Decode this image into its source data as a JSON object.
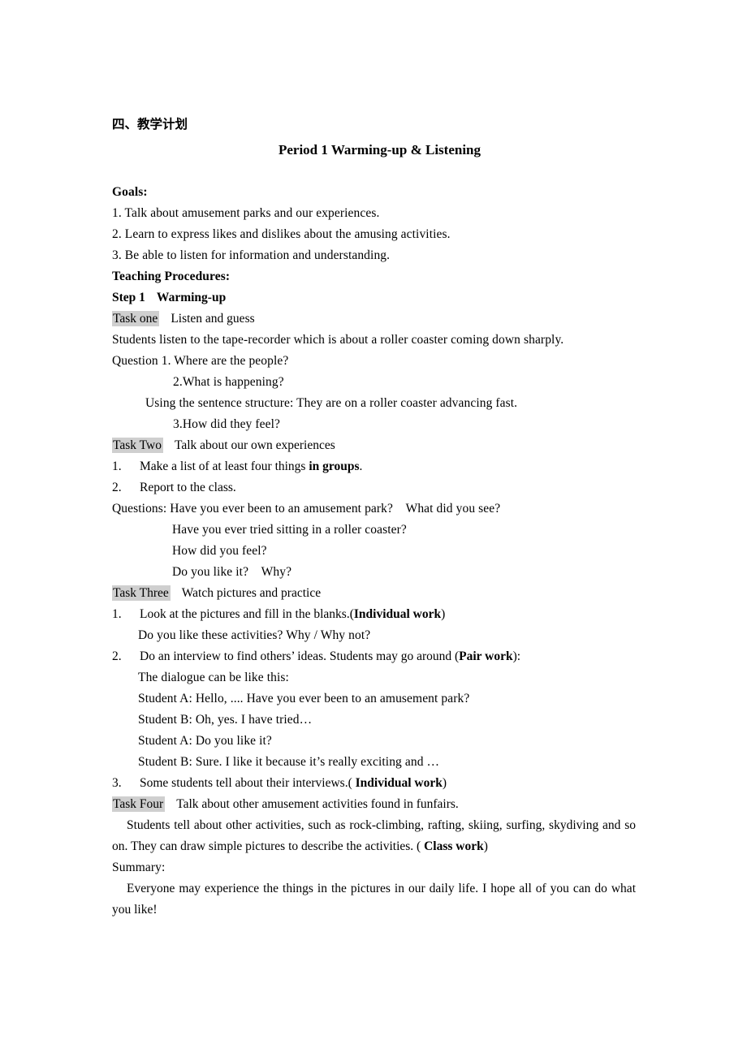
{
  "document": {
    "section_heading": "四、教学计划",
    "title": "Period 1 Warming-up & Listening",
    "goals_heading": "Goals:",
    "goals": [
      "1. Talk about amusement parks and our experiences.",
      "2. Learn to express likes and dislikes about the amusing activities.",
      "3. Be able to listen for information and understanding."
    ],
    "teaching_procedures_heading": "Teaching Procedures:",
    "step1": {
      "label": "Step 1",
      "title": "Warming-up"
    },
    "task_one": {
      "chip": "Task one",
      "heading": "Listen and guess",
      "intro": "Students listen to the tape-recorder which is about a roller coaster coming down sharply.",
      "question_1": "Question 1. Where are the people?",
      "question_2": "2.What is happening?",
      "structure": "Using the sentence structure: They are on a roller coaster advancing fast.",
      "question_3": "3.How did they feel?"
    },
    "task_two": {
      "chip": "Task Two",
      "heading": "Talk about our own experiences",
      "items": [
        {
          "num": "1.",
          "text_plain": "Make a list of at least four things ",
          "text_bold": "in groups",
          "text_tail": "."
        },
        {
          "num": "2.",
          "text_plain": "Report to the class.",
          "text_bold": "",
          "text_tail": ""
        }
      ],
      "questions_lead": "Questions: Have you ever been to an amusement park?    What did you see?",
      "questions": [
        "Have you ever tried sitting in a roller coaster?",
        "How did you feel?",
        "Do you like it?    Why?"
      ]
    },
    "task_three": {
      "chip": "Task Three",
      "heading": "Watch pictures and practice",
      "item1": {
        "num": "1.",
        "text_plain": "Look at the pictures and fill in the blanks.(",
        "text_bold": "Individual work",
        "text_tail": ")"
      },
      "item1_sub": "Do you like these activities? Why / Why not?",
      "item2": {
        "num": "2.",
        "text_plain": "Do an interview to find others’ ideas. Students may go around (",
        "text_bold": "Pair work",
        "text_tail": "):"
      },
      "dialogue_lead": "The dialogue can be like this:",
      "dialogue": [
        "Student A: Hello, .... Have you ever been to an amusement park?",
        "Student B: Oh, yes. I have tried…",
        "Student A: Do you like it?",
        "Student B: Sure. I like it because it’s really exciting and …"
      ],
      "item3": {
        "num": "3.",
        "text_plain": "Some students tell about their interviews.( ",
        "text_bold": "Individual work",
        "text_tail": ")"
      }
    },
    "task_four": {
      "chip": "Task Four",
      "heading": "Talk about other amusement activities found in funfairs.",
      "paragraph_plain_1": "Students tell about other activities, such as rock-climbing, rafting, skiing, surfing, skydiving and so on. They can draw simple pictures to describe the activities. ( ",
      "paragraph_bold": "Class work",
      "paragraph_plain_2": ")"
    },
    "summary": {
      "heading": "Summary:",
      "text": "Everyone may experience the things in the pictures in our daily life. I hope all of you can do what you like!"
    }
  },
  "colors": {
    "highlight": "#cfcfcf",
    "text": "#000000",
    "page_background": "#ffffff"
  }
}
